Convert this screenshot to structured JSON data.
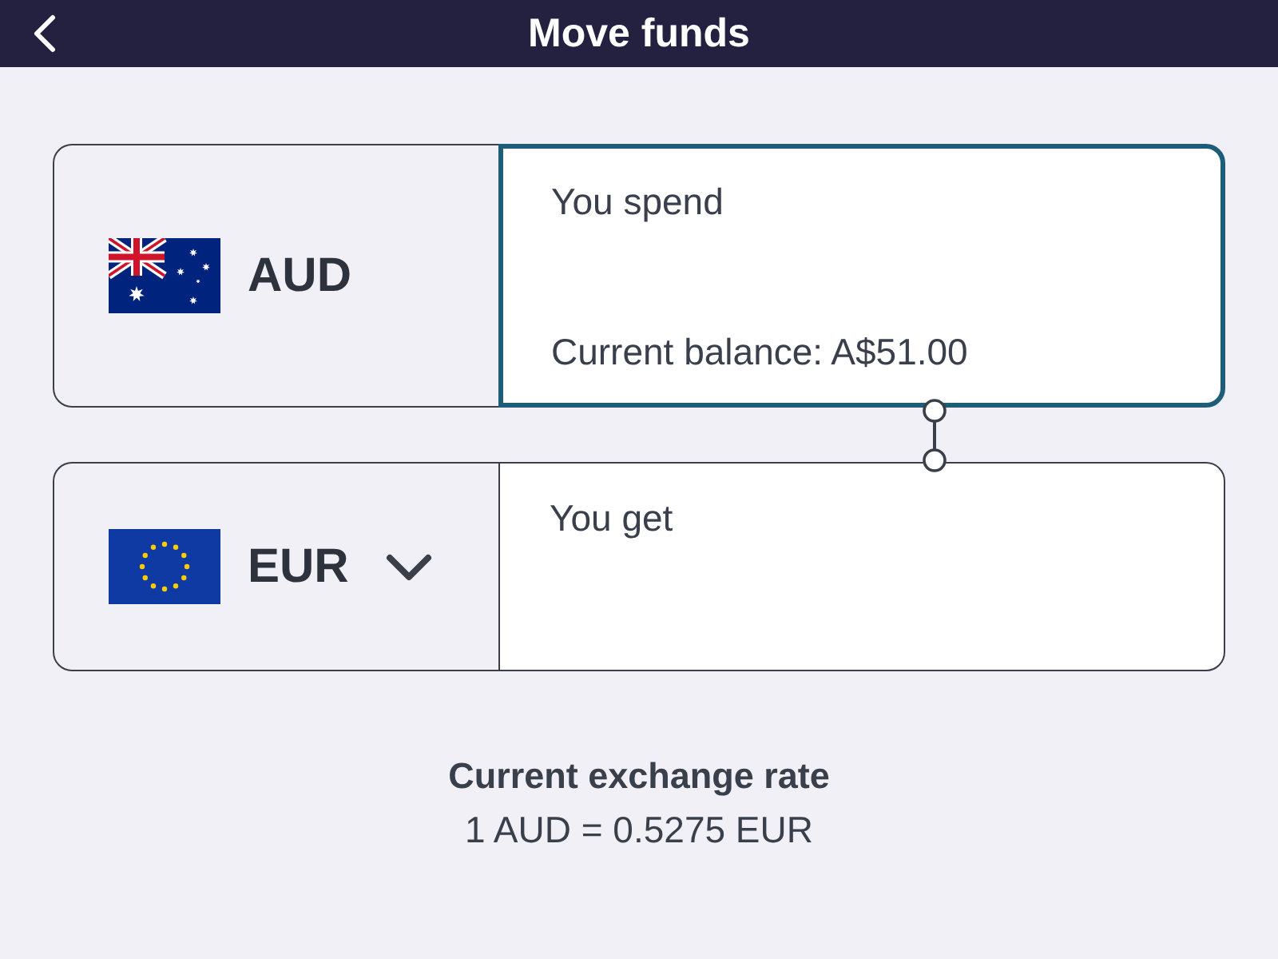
{
  "header": {
    "title": "Move funds"
  },
  "exchange": [
    {
      "currency": "AUD",
      "dropdown": false,
      "focused": true,
      "label": "You spend",
      "note": "Current balance: A$51.00"
    },
    {
      "currency": "EUR",
      "dropdown": true,
      "focused": false,
      "label": "You get"
    }
  ],
  "rate": {
    "title": "Current exchange rate",
    "value": "1 AUD = 0.5275 EUR"
  }
}
